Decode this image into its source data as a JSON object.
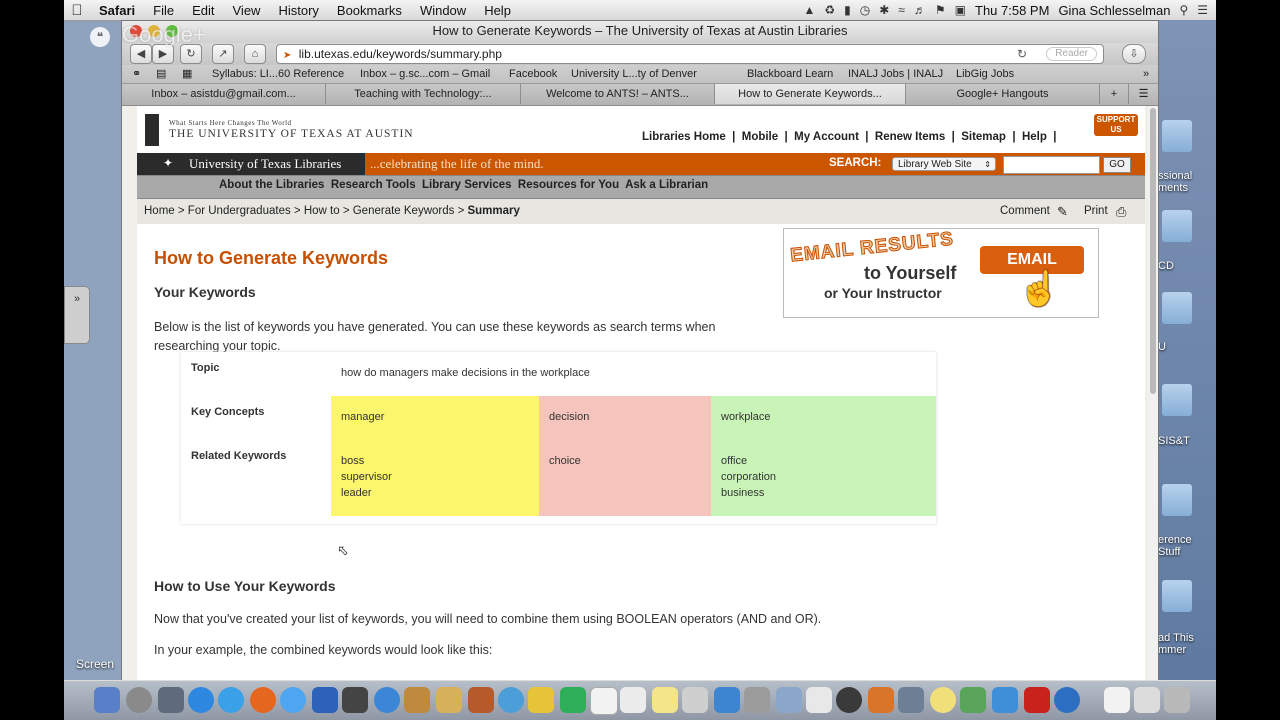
{
  "menubar": {
    "app": "Safari",
    "items": [
      "File",
      "Edit",
      "View",
      "History",
      "Bookmarks",
      "Window",
      "Help"
    ],
    "clock": "Thu 7:58 PM",
    "user": "Gina Schlesselman"
  },
  "overlay": {
    "hangouts_logo": "Google+"
  },
  "window": {
    "title": "How to Generate Keywords – The University of Texas at Austin Libraries",
    "url": "lib.utexas.edu/keywords/summary.php",
    "reader_label": "Reader"
  },
  "bookmarks": [
    "Syllabus: LI...60 Reference",
    "Inbox – g.sc...com – Gmail",
    "Facebook",
    "University L...ty of Denver",
    "Blackboard Learn",
    "INALJ Jobs | INALJ",
    "LibGig Jobs"
  ],
  "tabs": [
    "Inbox – asistdu@gmail.com...",
    "Teaching with Technology:...",
    "Welcome to ANTS! – ANTS...",
    "How to Generate Keywords...",
    "Google+ Hangouts"
  ],
  "ut": {
    "tagline_small": "What Starts Here Changes The World",
    "university": "THE UNIVERSITY OF TEXAS AT AUSTIN",
    "libraries_name": "University of Texas Libraries",
    "slogan": "...celebrating the life of the mind.",
    "top_links": [
      "Libraries Home",
      "Mobile",
      "My Account",
      "Renew Items",
      "Sitemap",
      "Help"
    ],
    "support_badge": "SUPPORT US",
    "search_label": "SEARCH:",
    "search_scope": "Library Web Site",
    "go_label": "GO",
    "nav": [
      "About the Libraries",
      "Research Tools",
      "Library Services",
      "Resources for You",
      "Ask a Librarian"
    ]
  },
  "breadcrumb": {
    "items": [
      "Home",
      "For Undergraduates",
      "How to",
      "Generate Keywords"
    ],
    "current": "Summary",
    "comment_label": "Comment",
    "print_label": "Print"
  },
  "page": {
    "title": "How to Generate Keywords",
    "h2_keywords": "Your Keywords",
    "intro": "Below is the list of keywords you have generated. You can use these keywords as search terms when researching your topic.",
    "email_promo": {
      "line1": "EMAIL RESULTS",
      "line2": "to Yourself",
      "line3": "or Your Instructor",
      "button": "EMAIL"
    },
    "table": {
      "topic_label": "Topic",
      "topic_value": "how do managers make decisions in the workplace",
      "concepts_label": "Key Concepts",
      "related_label": "Related Keywords",
      "columns": [
        {
          "concept": "manager",
          "related": [
            "boss",
            "supervisor",
            "leader"
          ],
          "color": "#fbf66b"
        },
        {
          "concept": "decision",
          "related": [
            "choice"
          ],
          "color": "#f4c4bd"
        },
        {
          "concept": "workplace",
          "related": [
            "office",
            "corporation",
            "business"
          ],
          "color": "#c8f5b7"
        }
      ]
    },
    "h2_use": "How to Use Your Keywords",
    "use_p1": "Now that you've created your list of keywords, you will need to combine them using BOOLEAN operators (AND and OR).",
    "use_p2": "In your example, the combined keywords would look like this:"
  },
  "desktop": {
    "labels": [
      "ssional\nments",
      "CD",
      "U",
      "SIS&T",
      "erence\nStuff",
      "ad This\nmmer"
    ],
    "screen_label": "Screen"
  }
}
